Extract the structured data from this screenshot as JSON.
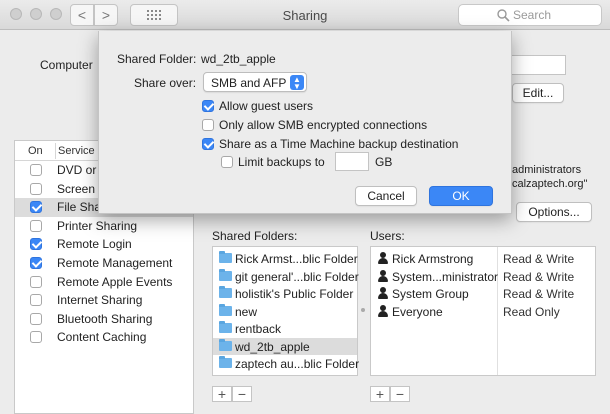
{
  "window": {
    "title": "Sharing"
  },
  "toolbar": {
    "search_placeholder": "Search",
    "back": "<",
    "forward": ">"
  },
  "computer_name": {
    "label": "Computer",
    "edit_button": "Edit..."
  },
  "access_text": {
    "line1": "administrators",
    "line2": "calzaptech.org\""
  },
  "options_button": "Options...",
  "services": {
    "col_on": "On",
    "col_service": "Service",
    "items": [
      {
        "name": "DVD or",
        "checked": false,
        "selected": false
      },
      {
        "name": "Screen",
        "checked": false,
        "selected": false
      },
      {
        "name": "File Sha",
        "checked": true,
        "selected": true
      },
      {
        "name": "Printer Sharing",
        "checked": false,
        "selected": false
      },
      {
        "name": "Remote Login",
        "checked": true,
        "selected": false
      },
      {
        "name": "Remote Management",
        "checked": true,
        "selected": false
      },
      {
        "name": "Remote Apple Events",
        "checked": false,
        "selected": false
      },
      {
        "name": "Internet Sharing",
        "checked": false,
        "selected": false
      },
      {
        "name": "Bluetooth Sharing",
        "checked": false,
        "selected": false
      },
      {
        "name": "Content Caching",
        "checked": false,
        "selected": false
      }
    ]
  },
  "shared_folders": {
    "label": "Shared Folders:",
    "items": [
      {
        "name": "Rick Armst...blic Folder",
        "selected": false
      },
      {
        "name": "git general'...blic Folder",
        "selected": false
      },
      {
        "name": "holistik's Public Folder",
        "selected": false
      },
      {
        "name": "new",
        "selected": false
      },
      {
        "name": "rentback",
        "selected": false
      },
      {
        "name": "wd_2tb_apple",
        "selected": true
      },
      {
        "name": "zaptech au...blic Folder",
        "selected": false
      }
    ],
    "add": "+",
    "remove": "−"
  },
  "users": {
    "label": "Users:",
    "items": [
      {
        "name": "Rick Armstrong",
        "permission": "Read & Write"
      },
      {
        "name": "System...ministrator",
        "permission": "Read & Write"
      },
      {
        "name": "System Group",
        "permission": "Read & Write"
      },
      {
        "name": "Everyone",
        "permission": "Read Only"
      }
    ],
    "add": "+",
    "remove": "−"
  },
  "sheet": {
    "shared_folder_label": "Shared Folder:",
    "shared_folder_value": "wd_2tb_apple",
    "share_over_label": "Share over:",
    "share_over_value": "SMB and AFP",
    "options": {
      "allow_guest": {
        "label": "Allow guest users",
        "checked": true
      },
      "smb_encrypted": {
        "label": "Only allow SMB encrypted connections",
        "checked": false
      },
      "time_machine": {
        "label": "Share as a Time Machine backup destination",
        "checked": true
      },
      "limit_backups": {
        "label": "Limit backups to",
        "unit": "GB",
        "checked": false,
        "value": ""
      }
    },
    "cancel": "Cancel",
    "ok": "OK"
  },
  "colors": {
    "accent": "#3b87f6"
  }
}
